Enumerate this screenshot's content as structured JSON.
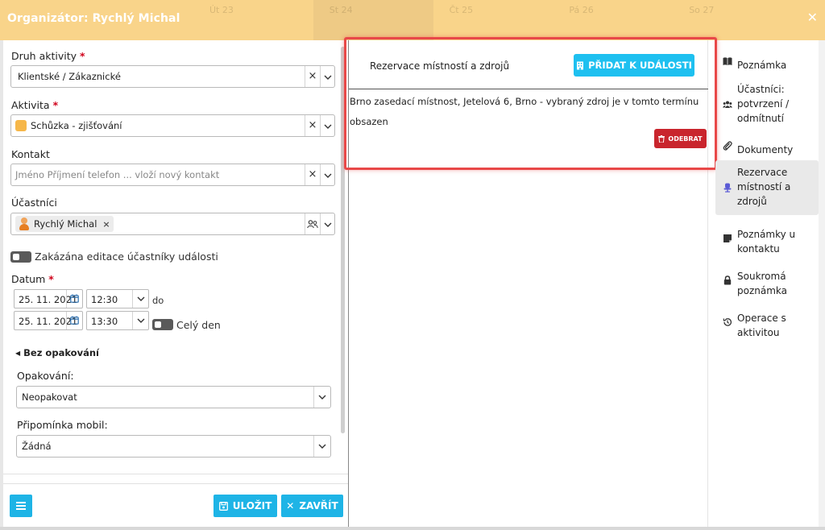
{
  "header": {
    "title": "Organizátor: Rychlý Michal",
    "bg_days": [
      "Út 23",
      "St 24",
      "Čt 25",
      "Pá 26",
      "So 27"
    ],
    "close_icon": "close-icon"
  },
  "form": {
    "activity_type": {
      "label": "Druh aktivity",
      "required_mark": "*",
      "value": "Klientské / Zákaznické"
    },
    "activity": {
      "label": "Aktivita",
      "required_mark": "*",
      "value": "Schůzka - zjišťování",
      "swatch_color": "#f6b749"
    },
    "contact": {
      "label": "Kontakt",
      "placeholder": "Jméno Příjmení telefon ... vloží nový kontakt"
    },
    "participants": {
      "label": "Účastníci",
      "chip": "Rychlý Michal",
      "chip_remove": "×"
    },
    "editing_toggle": {
      "label": "Zakázána editace účastníky události"
    },
    "date": {
      "label": "Datum",
      "required_mark": "*",
      "start_date": "25. 11. 2021",
      "start_time": "12:30",
      "to_label": "do",
      "end_date": "25. 11. 2021",
      "end_time": "13:30",
      "all_day_label": "Celý den"
    },
    "repeat_toggle": "Bez opakování",
    "repetition": {
      "label": "Opakování:",
      "value": "Neopakovat"
    },
    "reminder": {
      "label": "Připomínka mobil:",
      "value": "Žádná"
    },
    "clear_symbol": "×"
  },
  "footer": {
    "save_label": "ULOŽIT",
    "close_label": "ZAVŘÍT",
    "menu_icon": "hamburger-icon"
  },
  "reservation": {
    "title": "Rezervace místností a zdrojů",
    "add_button": "PŘIDAT K UDÁLOSTI",
    "message": "Brno zasedací místnost, Jetelová 6, Brno - vybraný zdroj je v tomto termínu obsazen",
    "remove_button": "ODEBRAT"
  },
  "side_nav": [
    {
      "label": "Poznámka",
      "icon": "book-icon"
    },
    {
      "label": "Účastníci: potvrzení / odmítnutí",
      "icon": "users-icon"
    },
    {
      "label": "Dokumenty",
      "icon": "paperclip-icon"
    },
    {
      "label": "Rezervace místností a zdrojů",
      "icon": "chair-icon"
    },
    {
      "label": "Poznámky u kontaktu",
      "icon": "sticky-note-icon"
    },
    {
      "label": "Soukromá poznámka",
      "icon": "lock-icon"
    },
    {
      "label": "Operace s aktivitou",
      "icon": "history-icon"
    }
  ],
  "colors": {
    "header": "#f9d48a",
    "accent": "#1eb4e6",
    "danger": "#c9252d",
    "highlight": "#e84848"
  }
}
